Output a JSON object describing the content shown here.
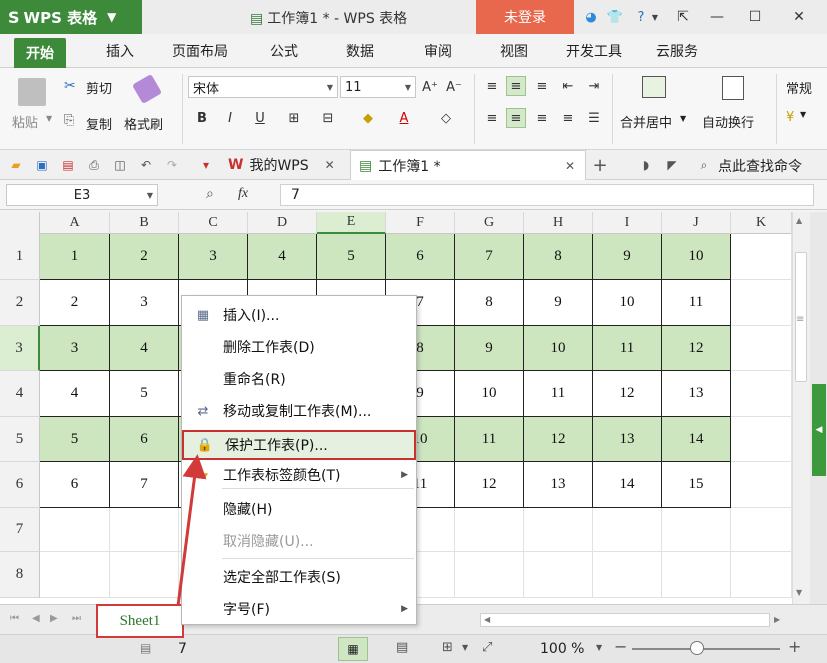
{
  "app": {
    "name": "WPS 表格",
    "logo_letter": "S",
    "window_title": "工作簿1 * - WPS 表格",
    "login_label": "未登录"
  },
  "ribbon_tabs": [
    "开始",
    "插入",
    "页面布局",
    "公式",
    "数据",
    "审阅",
    "视图",
    "开发工具",
    "云服务"
  ],
  "ribbon": {
    "paste": "粘贴",
    "cut": "剪切",
    "copy": "复制",
    "format_painter": "格式刷",
    "font_name": "宋体",
    "font_size": "11",
    "merge_center": "合并居中",
    "wrap_text": "自动换行",
    "general": "常规"
  },
  "doc_tabs": {
    "home": "我的WPS",
    "workbook": "工作簿1 *",
    "search": "点此查找命令"
  },
  "formula_bar": {
    "cell_ref": "E3",
    "fx": "fx",
    "value": "7"
  },
  "columns": [
    "A",
    "B",
    "C",
    "D",
    "E",
    "F",
    "G",
    "H",
    "I",
    "J",
    "K"
  ],
  "rows": [
    {
      "num": "1",
      "green": true,
      "values": [
        "1",
        "2",
        "3",
        "4",
        "5",
        "6",
        "7",
        "8",
        "9",
        "10"
      ]
    },
    {
      "num": "2",
      "green": false,
      "values": [
        "2",
        "3",
        "",
        "",
        "",
        "7",
        "8",
        "9",
        "10",
        "11"
      ]
    },
    {
      "num": "3",
      "green": true,
      "values": [
        "3",
        "4",
        "",
        "",
        "",
        "8",
        "9",
        "10",
        "11",
        "12"
      ]
    },
    {
      "num": "4",
      "green": false,
      "values": [
        "4",
        "5",
        "",
        "",
        "",
        "9",
        "10",
        "11",
        "12",
        "13"
      ]
    },
    {
      "num": "5",
      "green": true,
      "values": [
        "5",
        "6",
        "",
        "",
        "",
        "10",
        "11",
        "12",
        "13",
        "14"
      ]
    },
    {
      "num": "6",
      "green": false,
      "values": [
        "6",
        "7",
        "",
        "",
        "",
        "11",
        "12",
        "13",
        "14",
        "15"
      ]
    },
    {
      "num": "7",
      "green": false,
      "values": []
    },
    {
      "num": "8",
      "green": false,
      "values": []
    }
  ],
  "context_menu": [
    {
      "label": "插入(I)...",
      "icon": "table-insert-icon"
    },
    {
      "label": "删除工作表(D)"
    },
    {
      "label": "重命名(R)"
    },
    {
      "label": "移动或复制工作表(M)...",
      "icon": "move-copy-icon"
    },
    {
      "label": "保护工作表(P)...",
      "icon": "lock-icon",
      "highlight": true
    },
    {
      "label": "工作表标签颜色(T)",
      "icon": "tab-color-icon",
      "submenu": true
    },
    {
      "label": "隐藏(H)"
    },
    {
      "label": "取消隐藏(U)...",
      "disabled": true
    },
    {
      "label": "选定全部工作表(S)"
    },
    {
      "label": "字号(F)",
      "submenu": true
    }
  ],
  "sheet_tab": "Sheet1",
  "status": {
    "value": "7",
    "zoom": "100 %"
  },
  "colors": {
    "accent": "#3c8a3a",
    "highlight_red": "#d23a3a",
    "green_fill": "#cde6c0"
  }
}
